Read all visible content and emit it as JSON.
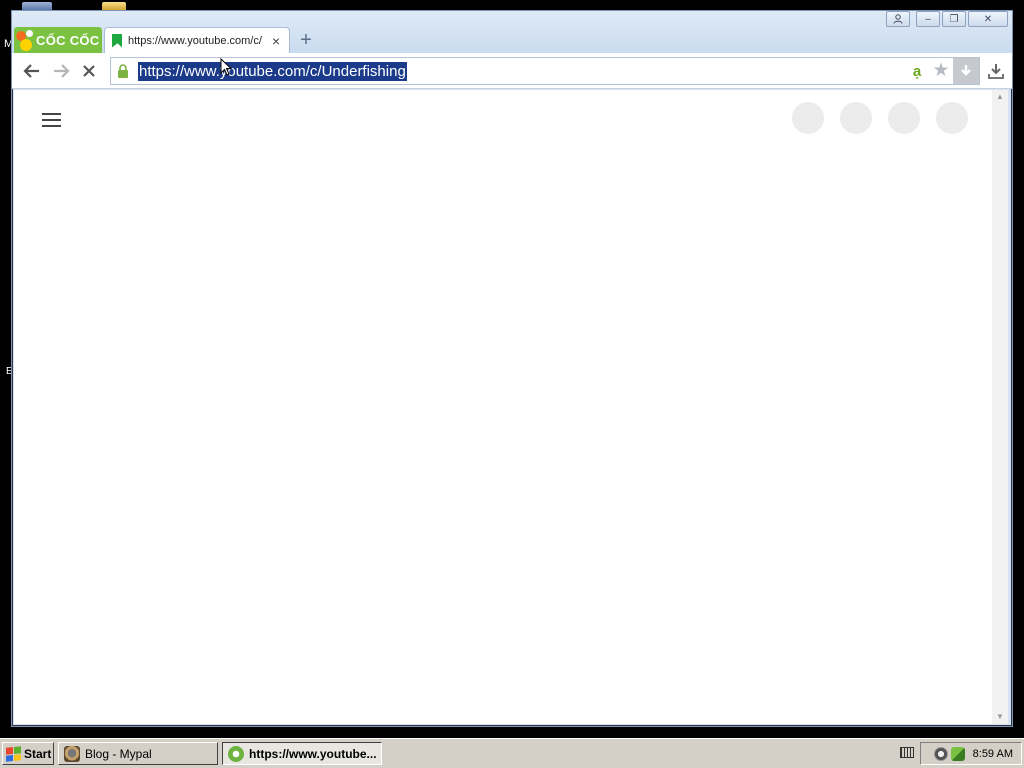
{
  "browser": {
    "brand_name": "CỐC CỐC",
    "tab": {
      "title": "https://www.youtube.com/c/",
      "close_symbol": "×"
    },
    "new_tab_symbol": "+",
    "address_bar": {
      "url": "https://www.youtube.com/c/Underfishing",
      "vietnamese_input_symbol": "ạ",
      "bookmark_symbol": "★"
    },
    "window_controls": {
      "minimize": "–",
      "restore": "❐",
      "close": "✕"
    }
  },
  "taskbar": {
    "start_label": "Start",
    "items": [
      {
        "label": "Blog - Mypal",
        "active": false
      },
      {
        "label": "https://www.youtube...",
        "active": true
      }
    ],
    "clock": "8:59 AM"
  },
  "icons": {
    "back": "arrow-left-icon",
    "forward": "arrow-right-icon",
    "stop": "stop-loading-icon",
    "lock": "lock-icon",
    "download": "download-icon",
    "menu": "hamburger-menu-icon"
  },
  "colors": {
    "brand_green": "#7cc242",
    "url_selection": "#1b3b8a",
    "placeholder_gray": "#ececec"
  }
}
